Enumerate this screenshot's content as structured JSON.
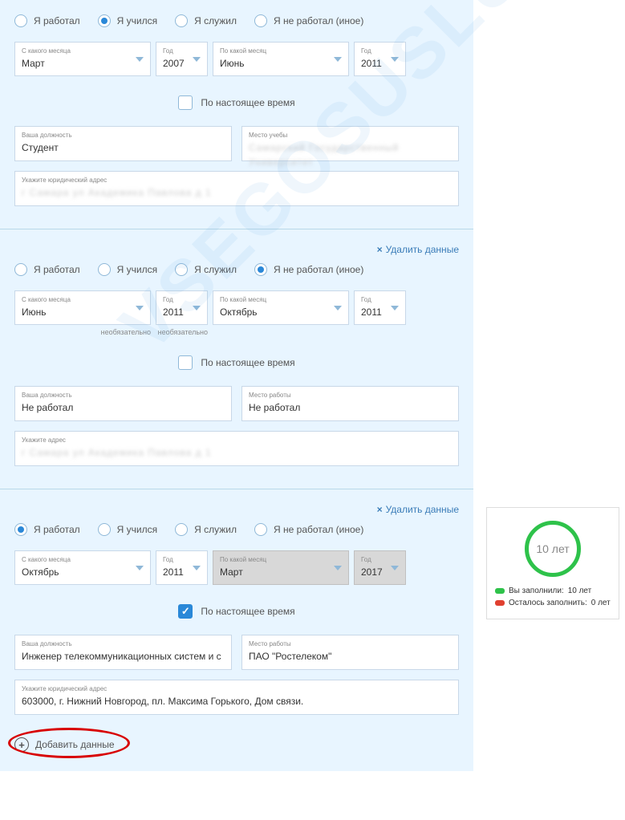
{
  "labels": {
    "radio_worked": "Я работал",
    "radio_studied": "Я учился",
    "radio_served": "Я служил",
    "radio_none": "Я не работал (иное)",
    "from_month": "С какого месяца",
    "year": "Год",
    "to_month": "По какой месяц",
    "present": "По настоящее время",
    "position": "Ваша должность",
    "study_place": "Место учебы",
    "work_place": "Место работы",
    "legal_address": "Укажите юридический адрес",
    "address": "Укажите адрес",
    "optional": "необязательно",
    "delete": "Удалить данные",
    "add": "Добавить данные"
  },
  "block1": {
    "from_month": "Март",
    "from_year": "2007",
    "to_month": "Июнь",
    "to_year": "2011",
    "present": false,
    "position": "Студент",
    "place": "",
    "address": ""
  },
  "block2": {
    "from_month": "Июнь",
    "from_year": "2011",
    "to_month": "Октябрь",
    "to_year": "2011",
    "present": false,
    "position": "Не работал",
    "place": "Не работал",
    "address": ""
  },
  "block3": {
    "from_month": "Октябрь",
    "from_year": "2011",
    "to_month": "Март",
    "to_year": "2017",
    "present": true,
    "position": "Инженер телекоммуникационных систем и с",
    "place": "ПАО \"Ростелеком\"",
    "address": "603000, г. Нижний Новгород, пл. Максима Горького, Дом связи."
  },
  "sidebar": {
    "ring_text": "10 лет",
    "filled_label": "Вы заполнили:",
    "filled_value": "10 лет",
    "remain_label": "Осталось заполнить:",
    "remain_value": "0 лет"
  },
  "watermark": "VSEGOSUSLUGI.RU"
}
